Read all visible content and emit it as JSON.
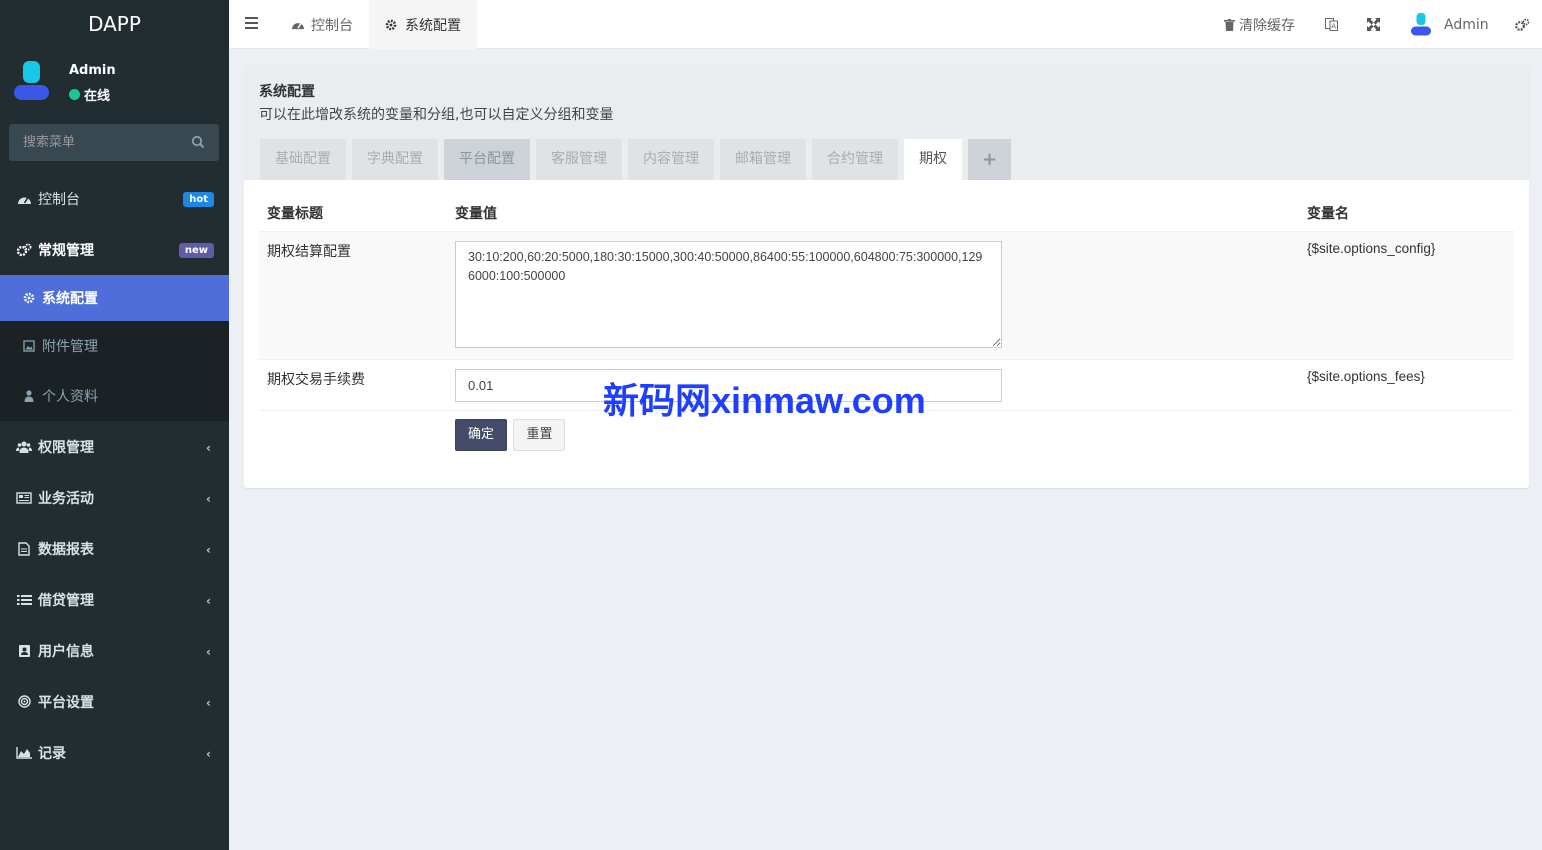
{
  "sidebar": {
    "brand": "DAPP",
    "user": {
      "name": "Admin",
      "status": "在线"
    },
    "search_placeholder": "搜索菜单",
    "items": [
      {
        "label": "控制台",
        "icon": "dashboard-icon",
        "badge": "hot"
      },
      {
        "label": "常规管理",
        "icon": "cogs-icon",
        "badge": "new"
      }
    ],
    "submenu": [
      {
        "label": "系统配置",
        "icon": "gear-icon"
      },
      {
        "label": "附件管理",
        "icon": "image-icon"
      },
      {
        "label": "个人资料",
        "icon": "user-icon"
      }
    ],
    "groups": [
      {
        "label": "权限管理",
        "icon": "users-icon"
      },
      {
        "label": "业务活动",
        "icon": "newspaper-icon"
      },
      {
        "label": "数据报表",
        "icon": "file-icon"
      },
      {
        "label": "借贷管理",
        "icon": "list-icon"
      },
      {
        "label": "用户信息",
        "icon": "contact-icon"
      },
      {
        "label": "平台设置",
        "icon": "target-icon"
      },
      {
        "label": "记录",
        "icon": "area-chart-icon"
      }
    ]
  },
  "header": {
    "tabs": [
      {
        "label": "控制台",
        "icon": "dashboard-icon"
      },
      {
        "label": "系统配置",
        "icon": "gear-icon"
      }
    ],
    "clear_cache": "清除缓存",
    "user": "Admin"
  },
  "panel": {
    "title": "系统配置",
    "description": "可以在此增改系统的变量和分组,也可以自定义分组和变量",
    "tabs": [
      "基础配置",
      "字典配置",
      "平台配置",
      "客服管理",
      "内容管理",
      "邮箱管理",
      "合约管理",
      "期权"
    ],
    "add_tab": "+",
    "columns": [
      "变量标题",
      "变量值",
      "变量名"
    ],
    "rows": [
      {
        "title": "期权结算配置",
        "value": "30:10:200,60:20:5000,180:30:15000,300:40:50000,86400:55:100000,604800:75:300000,1296000:100:500000",
        "name": "{$site.options_config}"
      },
      {
        "title": "期权交易手续费",
        "value": "0.01",
        "name": "{$site.options_fees}"
      }
    ],
    "submit": "确定",
    "reset": "重置"
  },
  "watermark": "新码网xinmaw.com",
  "colors": {
    "sidebar": "#222d32",
    "active": "#4f6eda",
    "primary_button": "#444c69"
  }
}
